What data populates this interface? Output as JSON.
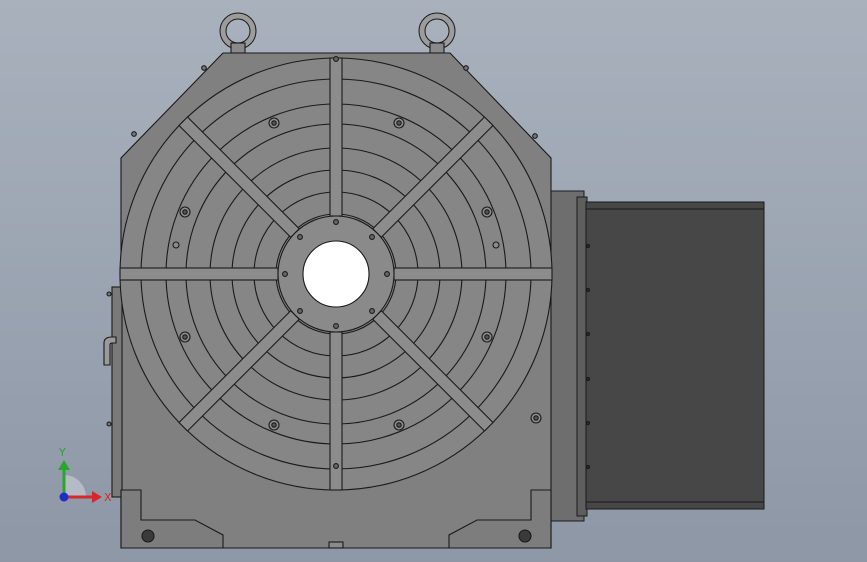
{
  "viewport": {
    "background_top": "#a9b1bd",
    "background_bottom": "#8d97a6"
  },
  "model": {
    "body_color": "#808080",
    "edge_color": "#1a1a1a",
    "motor_color": "#474747",
    "motor_flange_color": "#6e6e6e"
  },
  "triad": {
    "x_label": "X",
    "y_label": "Y",
    "x_color": "#d8262b",
    "y_color": "#2aa52e",
    "z_color": "#1f2cc8"
  }
}
